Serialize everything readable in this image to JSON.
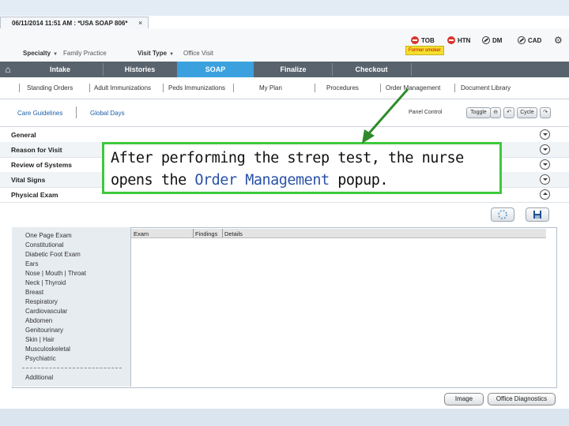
{
  "tab": {
    "title": "06/11/2014 11:51 AM : *USA SOAP 806*",
    "close": "×"
  },
  "header": {
    "specialty_label": "Specialty",
    "specialty_value": "Family Practice",
    "visit_type_label": "Visit Type",
    "visit_type_value": "Office Visit",
    "status": [
      {
        "label": "TOB",
        "icon": "no-entry-icon"
      },
      {
        "label": "HTN",
        "icon": "no-entry-icon"
      },
      {
        "label": "DM",
        "icon": "prohibited-icon"
      },
      {
        "label": "CAD",
        "icon": "prohibited-icon"
      }
    ],
    "former_smoker": "Former smoker"
  },
  "nav": {
    "home_icon": "⌂",
    "items": [
      "Intake",
      "Histories",
      "SOAP",
      "Finalize",
      "Checkout"
    ],
    "active": "SOAP"
  },
  "subnav": [
    "Standing Orders",
    "Adult Immunizations",
    "Peds Immunizations",
    "My Plan",
    "Procedures",
    "Order Management",
    "Document Library"
  ],
  "care": {
    "guidelines": "Care Guidelines",
    "global_days": "Global Days",
    "panel_control": "Panel Control",
    "toggle": "Toggle",
    "cycle": "Cycle"
  },
  "sections": [
    "General",
    "Reason for Visit",
    "Review of Systems",
    "Vital Signs",
    "Physical Exam"
  ],
  "callout": {
    "before": "After performing the strep test, the nurse opens the ",
    "highlight": "Order Management",
    "after": " popup."
  },
  "exam": {
    "list": [
      "One Page Exam",
      "Constitutional",
      "Diabetic Foot Exam",
      "Ears",
      "Nose | Mouth | Throat",
      "Neck | Thyroid",
      "Breast",
      "Respiratory",
      "Cardiovascular",
      "Abdomen",
      "Genitourinary",
      "Skin | Hair",
      "Musculoskeletal",
      "Psychiatric"
    ],
    "additional": "Additional",
    "columns": [
      "Exam",
      "Findings",
      "Details"
    ]
  },
  "footer": {
    "image": "Image",
    "office_diagnostics": "Office Diagnostics"
  },
  "colors": {
    "nav_bg": "#59636d",
    "active_tab": "#3aa1de",
    "callout_border": "#3ec93c",
    "arrow": "#2e8b2a",
    "link": "#1a5fa8"
  }
}
